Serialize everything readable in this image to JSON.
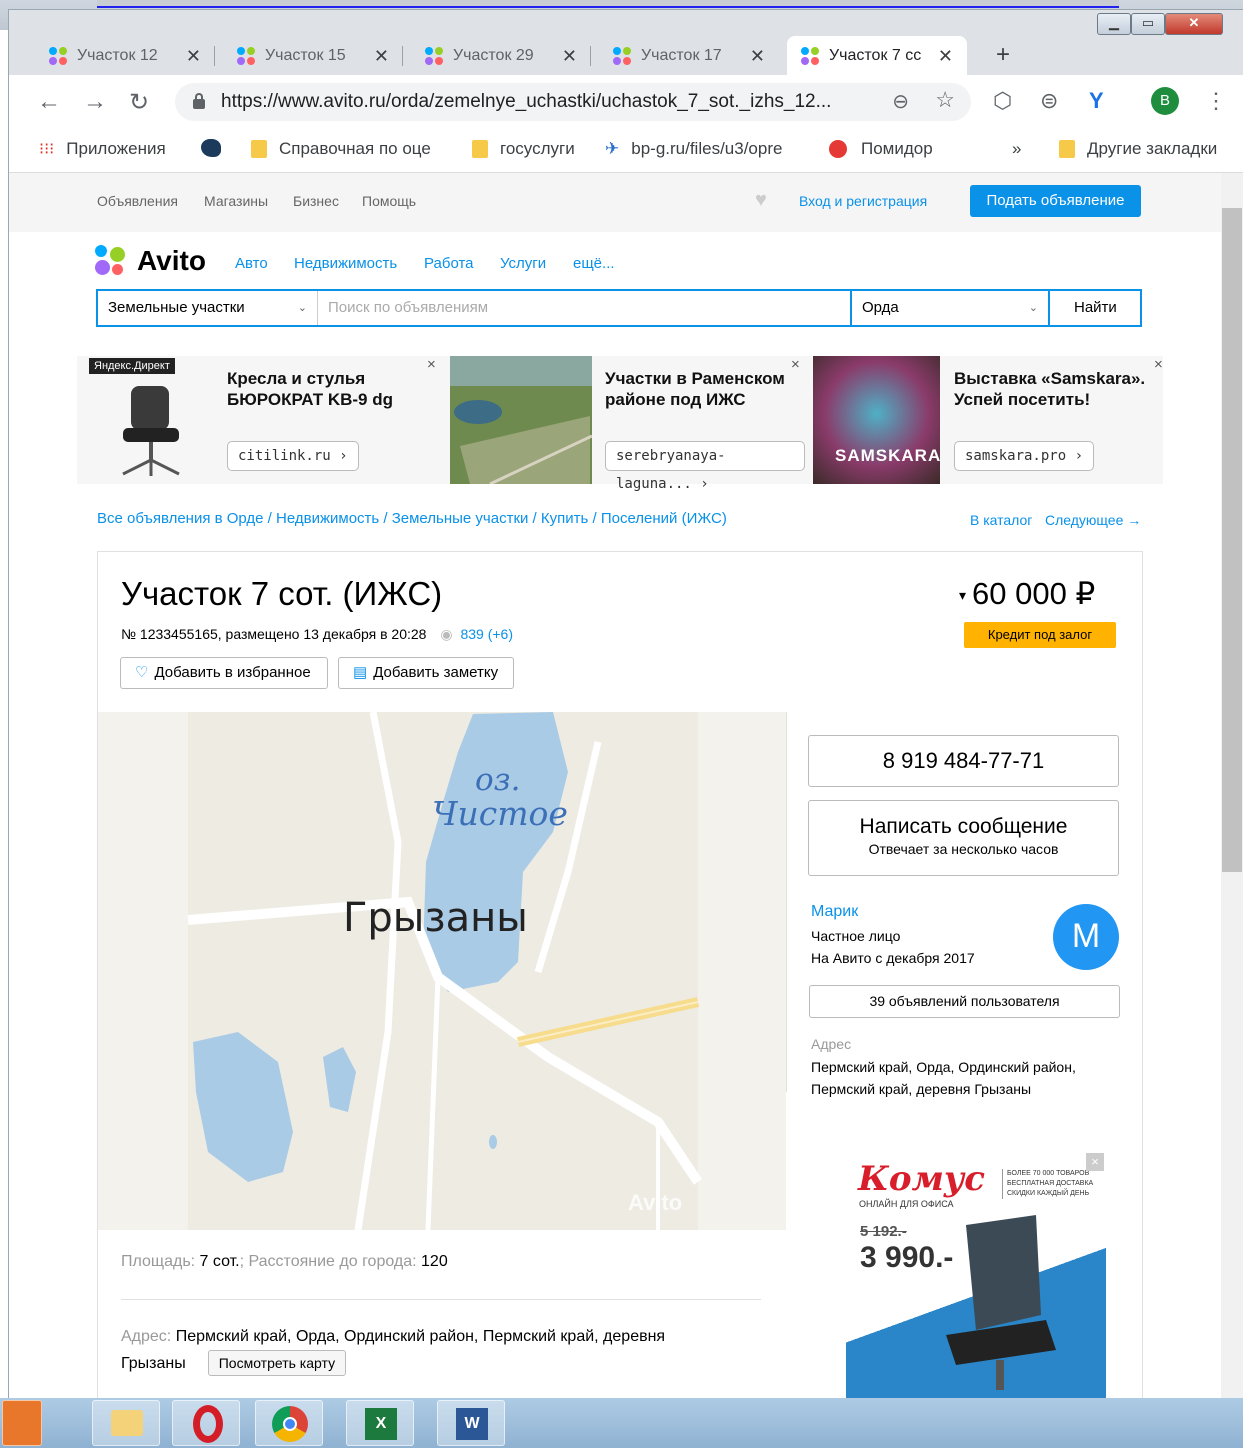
{
  "browser": {
    "tabs": [
      {
        "label": "Участок 12"
      },
      {
        "label": "Участок 15"
      },
      {
        "label": "Участок 29"
      },
      {
        "label": "Участок 17"
      },
      {
        "label": "Участок 7 сс"
      }
    ],
    "close_glyph": "✕",
    "new_tab_glyph": "+",
    "window_controls": {
      "minimize": "▭",
      "maximize": "▭",
      "close": "✕"
    },
    "url": "https://www.avito.ru/orda/zemelnye_uchastki/uchastok_7_sot._izhs_12...",
    "profile_initial": "B",
    "bookmarks": [
      {
        "label": "Приложения",
        "icon": "apps-grid-icon"
      },
      {
        "label": "",
        "icon": "bird-icon"
      },
      {
        "label": "Справочная по оце",
        "icon": "folder-icon"
      },
      {
        "label": "госуслуги",
        "icon": "folder-icon"
      },
      {
        "label": "bp-g.ru/files/u3/opre",
        "icon": "paper-plane-icon"
      },
      {
        "label": "Помидор",
        "icon": "red-dot-icon"
      }
    ],
    "bookmarks_overflow": "»",
    "other_bookmarks": "Другие закладки"
  },
  "site": {
    "utility_links": [
      "Объявления",
      "Магазины",
      "Бизнес",
      "Помощь"
    ],
    "login": "Вход и регистрация",
    "submit_ad": "Подать объявление",
    "logo": "Avito",
    "categories": [
      "Авто",
      "Недвижимость",
      "Работа",
      "Услуги",
      "ещё..."
    ],
    "search": {
      "category": "Земельные участки",
      "placeholder": "Поиск по объявлениям",
      "location": "Орда",
      "button": "Найти"
    },
    "ads": [
      {
        "badge": "Яндекс.Директ",
        "title": "Кресла и стулья БЮРОКРАТ KB-9 dg",
        "link": "citilink.ru ›"
      },
      {
        "title": "Участки в Раменском районе под ИЖС",
        "link": "serebryanaya-laguna... ›"
      },
      {
        "title": "Выставка «Samskara». Успей посетить!",
        "link": "samskara.pro ›",
        "image_text": "SAMSKARA"
      }
    ],
    "ad_close": "×",
    "breadcrumbs": "Все объявления в Орде / Недвижимость / Земельные участки / Купить / Поселений (ИЖС)",
    "to_catalog": "В каталог",
    "next": "Следующее →"
  },
  "listing": {
    "title": "Участок 7 сот. (ИЖС)",
    "meta": "№ 1233455165, размещено 13 декабря в 20:28",
    "views": "839 (+6)",
    "price": "60 000 ₽",
    "price_caret": "▾",
    "credit": "Кредит под залог",
    "fav": "Добавить в избранное",
    "note": "Добавить заметку",
    "map_labels": {
      "lake": "оз.",
      "lake2": "Чистое",
      "village": "Грызаны",
      "watermark": "Avito"
    },
    "params": {
      "area_label": "Площадь:",
      "area": "7 сот.",
      "dist_label": "; Расстояние до города:",
      "dist": "120"
    },
    "address_label": "Адрес:",
    "address": "Пермский край, Орда, Ординский район, Пермский край, деревня Грызаны",
    "show_map": "Посмотреть карту"
  },
  "seller": {
    "phone": "8 919 484-77-71",
    "write": "Написать сообщение",
    "write_sub": "Отвечает за несколько часов",
    "name": "Марик",
    "type": "Частное лицо",
    "since": "На Авито с декабря 2017",
    "avatar": "М",
    "user_ads": "39 объявлений пользователя",
    "address_label": "Адрес",
    "address": "Пермский край, Орда, Ординский район, Пермский край, деревня Грызаны"
  },
  "banner": {
    "brand": "Комус",
    "sub": "ОНЛАЙН ДЛЯ ОФИСА",
    "info": "БОЛЕЕ 70 000 ТОВАРОВ БЕСПЛАТНАЯ ДОСТАВКА СКИДКИ КАЖДЫЙ ДЕНЬ",
    "old_price": "5 192.-",
    "price": "3 990.-"
  },
  "colors": {
    "accent": "#0a91e8",
    "credit": "#ffb300",
    "avatar": "#2196f3"
  }
}
